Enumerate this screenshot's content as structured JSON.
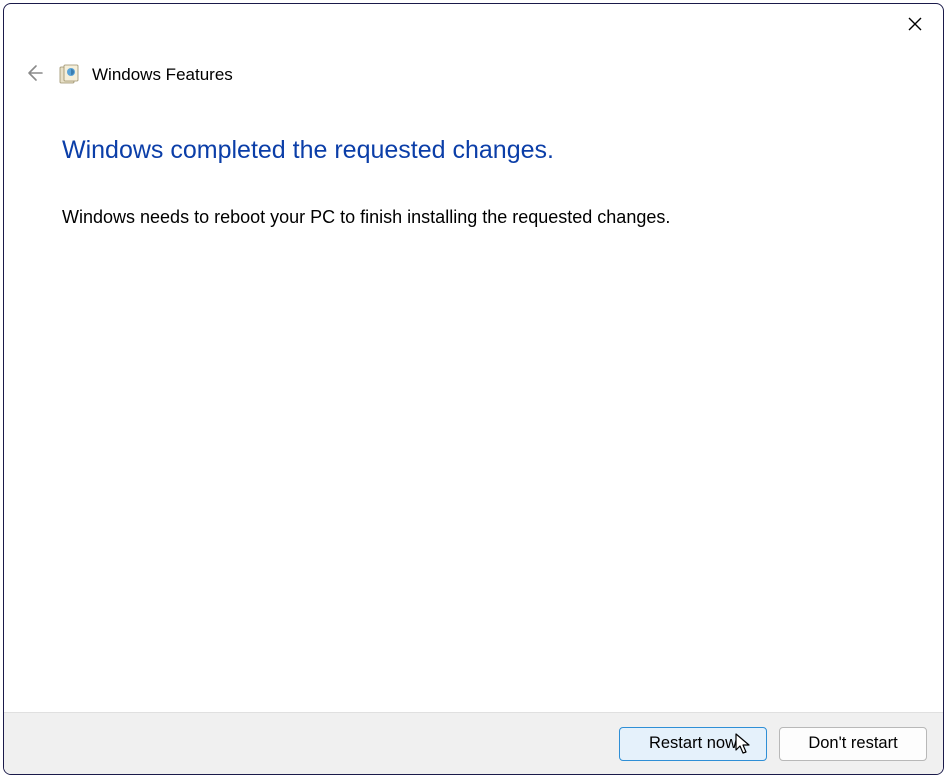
{
  "window": {
    "title": "Windows Features"
  },
  "main": {
    "heading": "Windows completed the requested changes.",
    "body": "Windows needs to reboot your PC to finish installing the requested changes."
  },
  "footer": {
    "primary_label": "Restart now",
    "secondary_label": "Don't restart"
  }
}
